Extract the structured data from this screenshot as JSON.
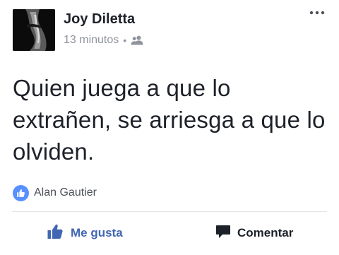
{
  "post": {
    "author": "Joy Diletta",
    "timestamp": "13 minutos",
    "separator": "•",
    "audience_icon": "friends-icon",
    "more_icon": "more-options-icon",
    "text": "Quien juega a que lo extrañen, se arriesga a que lo olviden.",
    "reactions": {
      "icon": "like-icon",
      "reactor": "Alan Gautier"
    },
    "actions": {
      "like_label": "Me gusta",
      "comment_label": "Comentar"
    }
  },
  "colors": {
    "like_blue": "#4267b2",
    "badge_blue": "#5890ff",
    "secondary_text": "#90949c",
    "primary_text": "#1d2129"
  }
}
